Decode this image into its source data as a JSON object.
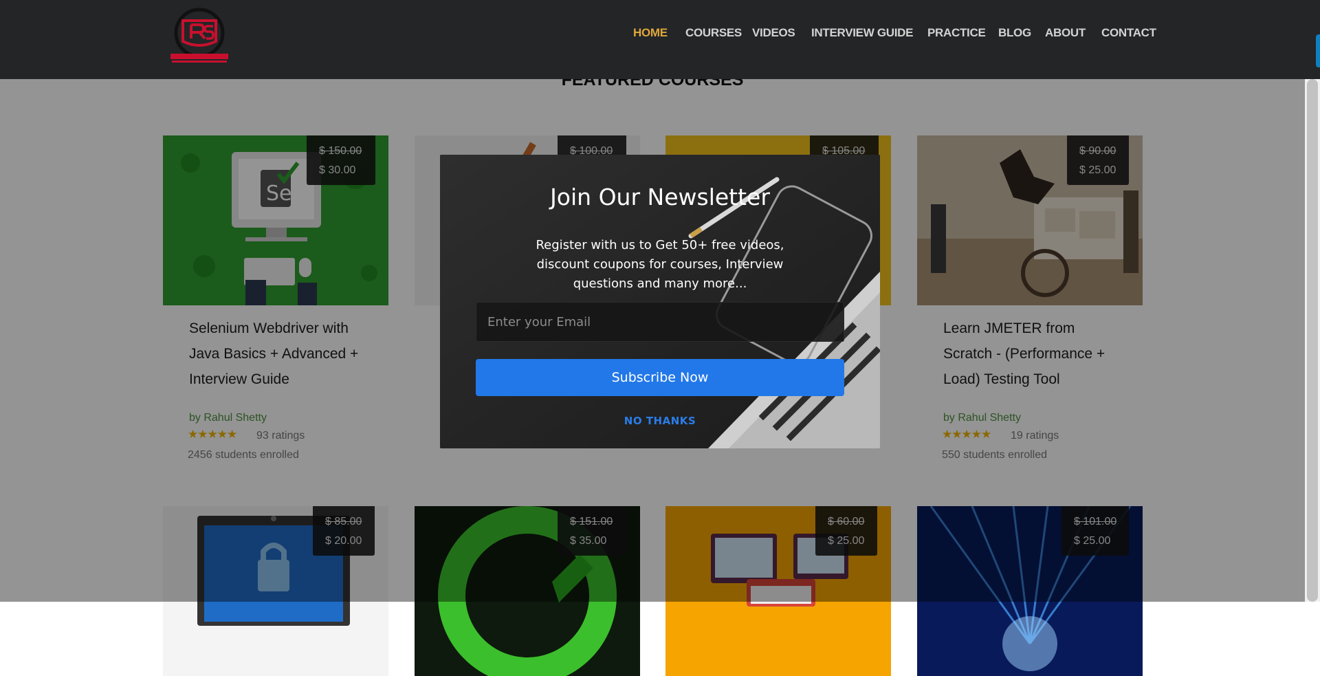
{
  "header": {
    "logo_alt": "Rahul Shetty Academy",
    "nav": [
      "HOME",
      "COURSES",
      "VIDEOS",
      "INTERVIEW GUIDE",
      "PRACTICE",
      "BLOG",
      "ABOUT",
      "CONTACT"
    ],
    "active": "HOME"
  },
  "section": {
    "title": "FEATURED COURSES"
  },
  "courses": [
    {
      "old_price": "$ 150.00",
      "new_price": "$ 30.00",
      "title": "Selenium Webdriver with Java Basics + Advanced + Interview Guide",
      "author": "by Rahul Shetty",
      "stars": "★★★★★",
      "ratings": "93 ratings",
      "enrolled": "2456 students enrolled"
    },
    {
      "old_price": "$ 100.00",
      "new_price": ""
    },
    {
      "old_price": "$ 105.00",
      "new_price": ""
    },
    {
      "old_price": "$ 90.00",
      "new_price": "$ 25.00",
      "title": "Learn JMETER from Scratch - (Performance + Load) Testing Tool",
      "author": "by Rahul Shetty",
      "stars": "★★★★★",
      "ratings": "19 ratings",
      "enrolled": "550 students enrolled"
    },
    {
      "old_price": "$ 85.00",
      "new_price": "$ 20.00"
    },
    {
      "old_price": "$ 151.00",
      "new_price": "$ 35.00"
    },
    {
      "old_price": "$ 60.00",
      "new_price": "$ 25.00"
    },
    {
      "old_price": "$ 101.00",
      "new_price": "$ 25.00"
    }
  ],
  "modal": {
    "title": "Join Our Newsletter",
    "text": "Register with us to Get 50+ free videos, discount coupons for courses, Interview questions and many more...",
    "email_placeholder": "Enter your Email",
    "subscribe_label": "Subscribe Now",
    "no_thanks_label": "NO THANKS"
  },
  "colors": {
    "header_bg": "#232527",
    "nav_active": "#e0a73a",
    "subscribe_btn": "#2278e8",
    "no_thanks": "#2b7de9",
    "author": "#4c8f3c",
    "stars": "#f0b400"
  }
}
